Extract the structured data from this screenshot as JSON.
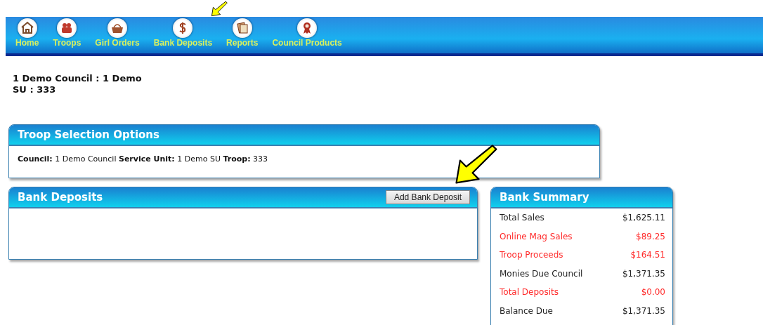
{
  "nav": [
    {
      "label": "Home"
    },
    {
      "label": "Troops"
    },
    {
      "label": "Girl Orders"
    },
    {
      "label": "Bank Deposits"
    },
    {
      "label": "Reports"
    },
    {
      "label": "Council Products"
    }
  ],
  "header": [
    "1 Demo Council : 1 Demo",
    "SU : 333"
  ],
  "troop_panel": {
    "title": "Troop Selection Options",
    "fields": [
      {
        "label": "Council:",
        "value": "1 Demo Council"
      },
      {
        "label": "Service Unit:",
        "value": "1 Demo SU"
      },
      {
        "label": "Troop:",
        "value": "333"
      }
    ]
  },
  "deposits_panel": {
    "title": "Bank Deposits",
    "button": "Add Bank Deposit"
  },
  "summary": {
    "title": "Bank Summary",
    "rows": [
      {
        "label": "Total Sales",
        "amount": "$1,625.11",
        "color": "#222222"
      },
      {
        "label": "Online Mag Sales",
        "amount": "$89.25",
        "color": "#ff2a2a"
      },
      {
        "label": "Troop Proceeds",
        "amount": "$164.51",
        "color": "#ff2a2a"
      },
      {
        "label": "Monies Due Council",
        "amount": "$1,371.35",
        "color": "#222222"
      },
      {
        "label": "Total Deposits",
        "amount": "$0.00",
        "color": "#ff2a2a"
      },
      {
        "label": "Balance Due",
        "amount": "$1,371.35",
        "color": "#222222"
      }
    ]
  }
}
